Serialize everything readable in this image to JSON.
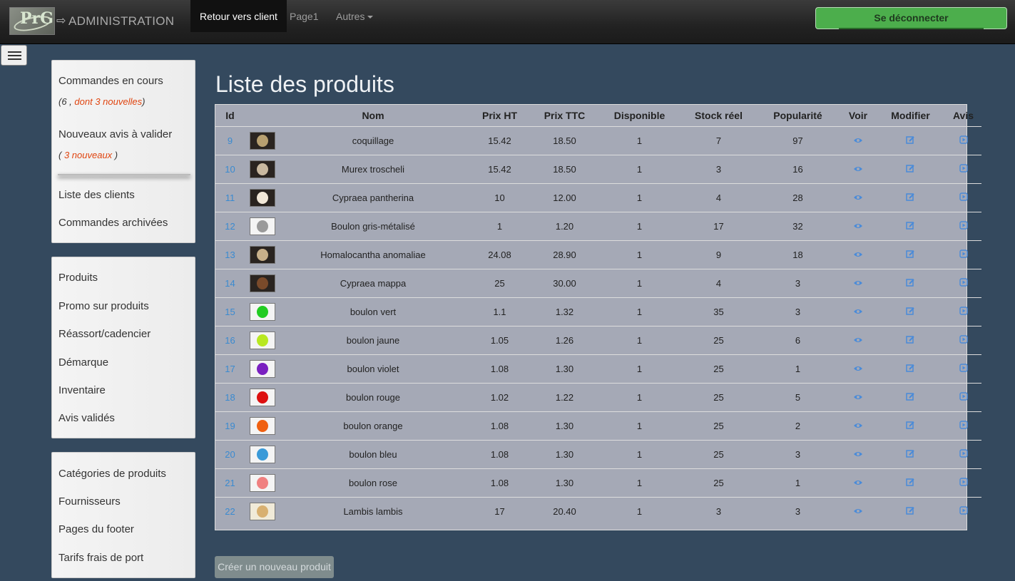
{
  "header": {
    "logo_text": "PrG",
    "arrow": "⇨",
    "title": "ADMINISTRATION",
    "nav": [
      "Retour vers client",
      "Page1",
      "Autres"
    ],
    "logout_label": "Se déconnecter"
  },
  "sidebar": {
    "panel1": {
      "commandes_label": "Commandes en cours",
      "commandes_count_prefix": "(6 , ",
      "commandes_new": "dont 3 nouvelles",
      "commandes_count_suffix": ")",
      "avis_label": "Nouveaux avis à valider",
      "avis_prefix": "( ",
      "avis_new": "3 nouveaux",
      "avis_suffix": " )",
      "clients_label": "Liste des clients",
      "archives_label": "Commandes archivées"
    },
    "panel2": [
      "Produits",
      "Promo sur produits",
      "Réassort/cadencier",
      "Démarque",
      "Inventaire",
      "Avis validés"
    ],
    "panel3": [
      "Catégories de produits",
      "Fournisseurs",
      "Pages du footer",
      "Tarifs frais de port"
    ]
  },
  "main": {
    "title": "Liste des produits",
    "columns": [
      "Id",
      "",
      "Nom",
      "Prix HT",
      "Prix TTC",
      "Disponible",
      "Stock réel",
      "Popularité",
      "Voir",
      "Modifier",
      "Avis"
    ],
    "rows": [
      {
        "id": "9",
        "nom": "coquillage",
        "ht": "15.42",
        "ttc": "18.50",
        "dispo": "1",
        "stock": "7",
        "pop": "97",
        "thumb": "#b8a070"
      },
      {
        "id": "10",
        "nom": "Murex troscheli",
        "ht": "15.42",
        "ttc": "18.50",
        "dispo": "1",
        "stock": "3",
        "pop": "16",
        "thumb": "#c9b9a0"
      },
      {
        "id": "11",
        "nom": "Cypraea pantherina",
        "ht": "10",
        "ttc": "12.00",
        "dispo": "1",
        "stock": "4",
        "pop": "28",
        "thumb": "#f2e8d8"
      },
      {
        "id": "12",
        "nom": "Boulon gris-métalisé",
        "ht": "1",
        "ttc": "1.20",
        "dispo": "1",
        "stock": "17",
        "pop": "32",
        "thumb": "#9a9a9a"
      },
      {
        "id": "13",
        "nom": "Homalocantha anomaliae",
        "ht": "24.08",
        "ttc": "28.90",
        "dispo": "1",
        "stock": "9",
        "pop": "18",
        "thumb": "#c8b08a"
      },
      {
        "id": "14",
        "nom": "Cypraea mappa",
        "ht": "25",
        "ttc": "30.00",
        "dispo": "1",
        "stock": "4",
        "pop": "3",
        "thumb": "#7a4a2a"
      },
      {
        "id": "15",
        "nom": "boulon vert",
        "ht": "1.1",
        "ttc": "1.32",
        "dispo": "1",
        "stock": "35",
        "pop": "3",
        "thumb": "#22cc22"
      },
      {
        "id": "16",
        "nom": "boulon jaune",
        "ht": "1.05",
        "ttc": "1.26",
        "dispo": "1",
        "stock": "25",
        "pop": "6",
        "thumb": "#b8e820"
      },
      {
        "id": "17",
        "nom": "boulon violet",
        "ht": "1.08",
        "ttc": "1.30",
        "dispo": "1",
        "stock": "25",
        "pop": "1",
        "thumb": "#7a20c0"
      },
      {
        "id": "18",
        "nom": "boulon rouge",
        "ht": "1.02",
        "ttc": "1.22",
        "dispo": "1",
        "stock": "25",
        "pop": "5",
        "thumb": "#dd1010"
      },
      {
        "id": "19",
        "nom": "boulon orange",
        "ht": "1.08",
        "ttc": "1.30",
        "dispo": "1",
        "stock": "25",
        "pop": "2",
        "thumb": "#f06010"
      },
      {
        "id": "20",
        "nom": "boulon bleu",
        "ht": "1.08",
        "ttc": "1.30",
        "dispo": "1",
        "stock": "25",
        "pop": "3",
        "thumb": "#3a9ad8"
      },
      {
        "id": "21",
        "nom": "boulon rose",
        "ht": "1.08",
        "ttc": "1.30",
        "dispo": "1",
        "stock": "25",
        "pop": "1",
        "thumb": "#f08080"
      },
      {
        "id": "22",
        "nom": "Lambis lambis",
        "ht": "17",
        "ttc": "20.40",
        "dispo": "1",
        "stock": "3",
        "pop": "3",
        "thumb": "#d8b070"
      }
    ],
    "icons": {
      "voir": "eye-icon",
      "modifier": "edit-icon",
      "avis": "play-icon"
    },
    "create_label": "Créer un nouveau produit"
  },
  "colors": {
    "background": "#34495e",
    "link": "#3a8ad0",
    "accent_green": "#4cae4c",
    "highlight_red": "#e0440f"
  }
}
